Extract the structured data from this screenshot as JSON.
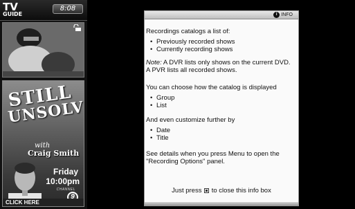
{
  "guide": {
    "logo_top": "TV",
    "logo_bottom": "GUIDE",
    "clock": "8:08"
  },
  "promo": {
    "line1": "STILL",
    "line2": "UNSOLVED",
    "with": "with",
    "host": "Craig Smith",
    "day": "Friday",
    "time": "10:00pm",
    "channel_label": "CHANNEL",
    "channel_number": "9",
    "cta": "CLICK HERE"
  },
  "info": {
    "badge_label": "INFO",
    "intro": "Recordings catalogs a list of:",
    "catalog_items": [
      "Previously recorded shows",
      "Currently recording shows"
    ],
    "note_lead": "Note:",
    "note_rest": " A DVR lists only shows on the current DVD.",
    "note_line2": "A PVR lists all recorded shows.",
    "display_intro": "You can choose how the catalog is displayed",
    "display_items": [
      "Group",
      "List"
    ],
    "customize_intro": "And even customize further by",
    "customize_items": [
      "Date",
      "Title"
    ],
    "details_line1": "See details when you press Menu to open the",
    "details_line2": "\"Recording Options\" panel.",
    "close_before": "Just press ",
    "close_after": " to close this info box"
  },
  "icons": {
    "lock": "lock-icon",
    "info": "info-icon",
    "key": "key-icon"
  }
}
